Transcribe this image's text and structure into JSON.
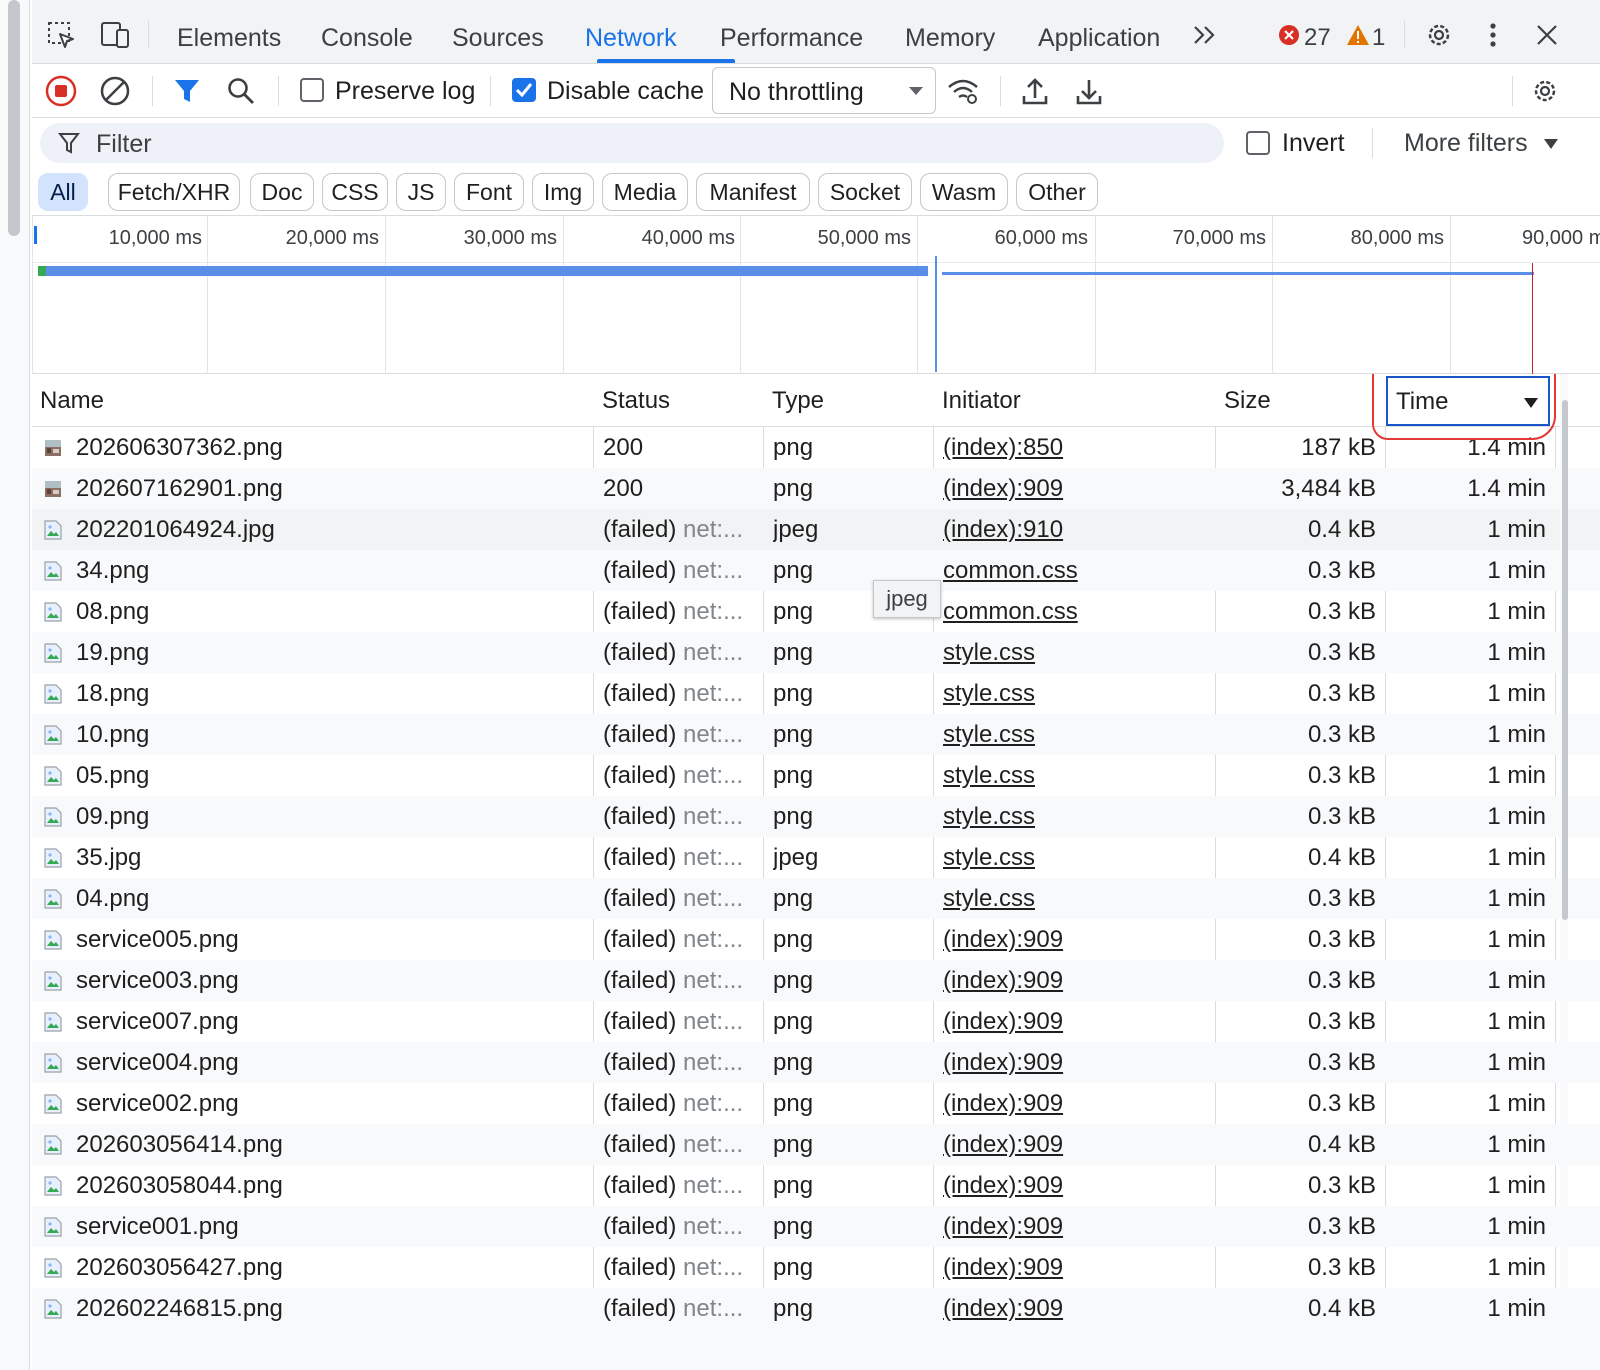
{
  "tabs": [
    {
      "label": "Elements"
    },
    {
      "label": "Console"
    },
    {
      "label": "Sources"
    },
    {
      "label": "Network",
      "active": true
    },
    {
      "label": "Performance"
    },
    {
      "label": "Memory"
    },
    {
      "label": "Application"
    }
  ],
  "issues": {
    "errors": "27",
    "warnings": "1"
  },
  "toolbar": {
    "preserve_log_label": "Preserve log",
    "preserve_log_checked": false,
    "disable_cache_label": "Disable cache",
    "disable_cache_checked": true,
    "throttling_value": "No throttling"
  },
  "filter": {
    "placeholder": "Filter",
    "invert_label": "Invert",
    "more_filters_label": "More filters"
  },
  "type_filters": [
    "All",
    "Fetch/XHR",
    "Doc",
    "CSS",
    "JS",
    "Font",
    "Img",
    "Media",
    "Manifest",
    "Socket",
    "Wasm",
    "Other"
  ],
  "active_type_filter": "All",
  "overview": {
    "tick_labels": [
      "10,000 ms",
      "20,000 ms",
      "30,000 ms",
      "40,000 ms",
      "50,000 ms",
      "60,000 ms",
      "70,000 ms",
      "80,000 ms",
      "90,000 ms"
    ]
  },
  "table": {
    "columns": [
      "Name",
      "Status",
      "Type",
      "Initiator",
      "Size",
      "Time"
    ],
    "sorted_column": "Time",
    "sort_direction": "descending",
    "rows": [
      {
        "name": "202606307362.png",
        "status": "200",
        "status_detail": "",
        "type": "png",
        "initiator": "(index):850",
        "size": "187 kB",
        "time": "1.4 min",
        "icon": "image-thumbnail-icon"
      },
      {
        "name": "202607162901.png",
        "status": "200",
        "status_detail": "",
        "type": "png",
        "initiator": "(index):909",
        "size": "3,484 kB",
        "time": "1.4 min",
        "icon": "image-thumbnail-icon"
      },
      {
        "name": "202201064924.jpg",
        "status": "(failed)",
        "status_detail": "net:...",
        "type": "jpeg",
        "initiator": "(index):910",
        "size": "0.4 kB",
        "time": "1 min",
        "icon": "broken-image-icon"
      },
      {
        "name": "34.png",
        "status": "(failed)",
        "status_detail": "net:...",
        "type": "png",
        "initiator": "common.css",
        "size": "0.3 kB",
        "time": "1 min",
        "icon": "broken-image-icon"
      },
      {
        "name": "08.png",
        "status": "(failed)",
        "status_detail": "net:...",
        "type": "png",
        "initiator": "common.css",
        "size": "0.3 kB",
        "time": "1 min",
        "icon": "broken-image-icon"
      },
      {
        "name": "19.png",
        "status": "(failed)",
        "status_detail": "net:...",
        "type": "png",
        "initiator": "style.css",
        "size": "0.3 kB",
        "time": "1 min",
        "icon": "broken-image-icon"
      },
      {
        "name": "18.png",
        "status": "(failed)",
        "status_detail": "net:...",
        "type": "png",
        "initiator": "style.css",
        "size": "0.3 kB",
        "time": "1 min",
        "icon": "broken-image-icon"
      },
      {
        "name": "10.png",
        "status": "(failed)",
        "status_detail": "net:...",
        "type": "png",
        "initiator": "style.css",
        "size": "0.3 kB",
        "time": "1 min",
        "icon": "broken-image-icon"
      },
      {
        "name": "05.png",
        "status": "(failed)",
        "status_detail": "net:...",
        "type": "png",
        "initiator": "style.css",
        "size": "0.3 kB",
        "time": "1 min",
        "icon": "broken-image-icon"
      },
      {
        "name": "09.png",
        "status": "(failed)",
        "status_detail": "net:...",
        "type": "png",
        "initiator": "style.css",
        "size": "0.3 kB",
        "time": "1 min",
        "icon": "broken-image-icon"
      },
      {
        "name": "35.jpg",
        "status": "(failed)",
        "status_detail": "net:...",
        "type": "jpeg",
        "initiator": "style.css",
        "size": "0.4 kB",
        "time": "1 min",
        "icon": "broken-image-icon"
      },
      {
        "name": "04.png",
        "status": "(failed)",
        "status_detail": "net:...",
        "type": "png",
        "initiator": "style.css",
        "size": "0.3 kB",
        "time": "1 min",
        "icon": "broken-image-icon"
      },
      {
        "name": "service005.png",
        "status": "(failed)",
        "status_detail": "net:...",
        "type": "png",
        "initiator": "(index):909",
        "size": "0.3 kB",
        "time": "1 min",
        "icon": "broken-image-icon"
      },
      {
        "name": "service003.png",
        "status": "(failed)",
        "status_detail": "net:...",
        "type": "png",
        "initiator": "(index):909",
        "size": "0.3 kB",
        "time": "1 min",
        "icon": "broken-image-icon"
      },
      {
        "name": "service007.png",
        "status": "(failed)",
        "status_detail": "net:...",
        "type": "png",
        "initiator": "(index):909",
        "size": "0.3 kB",
        "time": "1 min",
        "icon": "broken-image-icon"
      },
      {
        "name": "service004.png",
        "status": "(failed)",
        "status_detail": "net:...",
        "type": "png",
        "initiator": "(index):909",
        "size": "0.3 kB",
        "time": "1 min",
        "icon": "broken-image-icon"
      },
      {
        "name": "service002.png",
        "status": "(failed)",
        "status_detail": "net:...",
        "type": "png",
        "initiator": "(index):909",
        "size": "0.3 kB",
        "time": "1 min",
        "icon": "broken-image-icon"
      },
      {
        "name": "202603056414.png",
        "status": "(failed)",
        "status_detail": "net:...",
        "type": "png",
        "initiator": "(index):909",
        "size": "0.4 kB",
        "time": "1 min",
        "icon": "broken-image-icon"
      },
      {
        "name": "202603058044.png",
        "status": "(failed)",
        "status_detail": "net:...",
        "type": "png",
        "initiator": "(index):909",
        "size": "0.3 kB",
        "time": "1 min",
        "icon": "broken-image-icon"
      },
      {
        "name": "service001.png",
        "status": "(failed)",
        "status_detail": "net:...",
        "type": "png",
        "initiator": "(index):909",
        "size": "0.3 kB",
        "time": "1 min",
        "icon": "broken-image-icon"
      },
      {
        "name": "202603056427.png",
        "status": "(failed)",
        "status_detail": "net:...",
        "type": "png",
        "initiator": "(index):909",
        "size": "0.3 kB",
        "time": "1 min",
        "icon": "broken-image-icon"
      },
      {
        "name": "202602246815.png",
        "status": "(failed)",
        "status_detail": "net:...",
        "type": "png",
        "initiator": "(index):909",
        "size": "0.4 kB",
        "time": "1 min",
        "icon": "broken-image-icon"
      }
    ]
  },
  "tooltip": {
    "text": "jpeg"
  },
  "colors": {
    "accent": "#1a73e8",
    "error": "#d93025",
    "warning": "#e37400",
    "record": "#d93025",
    "annotation": "#e53935",
    "timeline_bar": "#5b8ee6"
  }
}
